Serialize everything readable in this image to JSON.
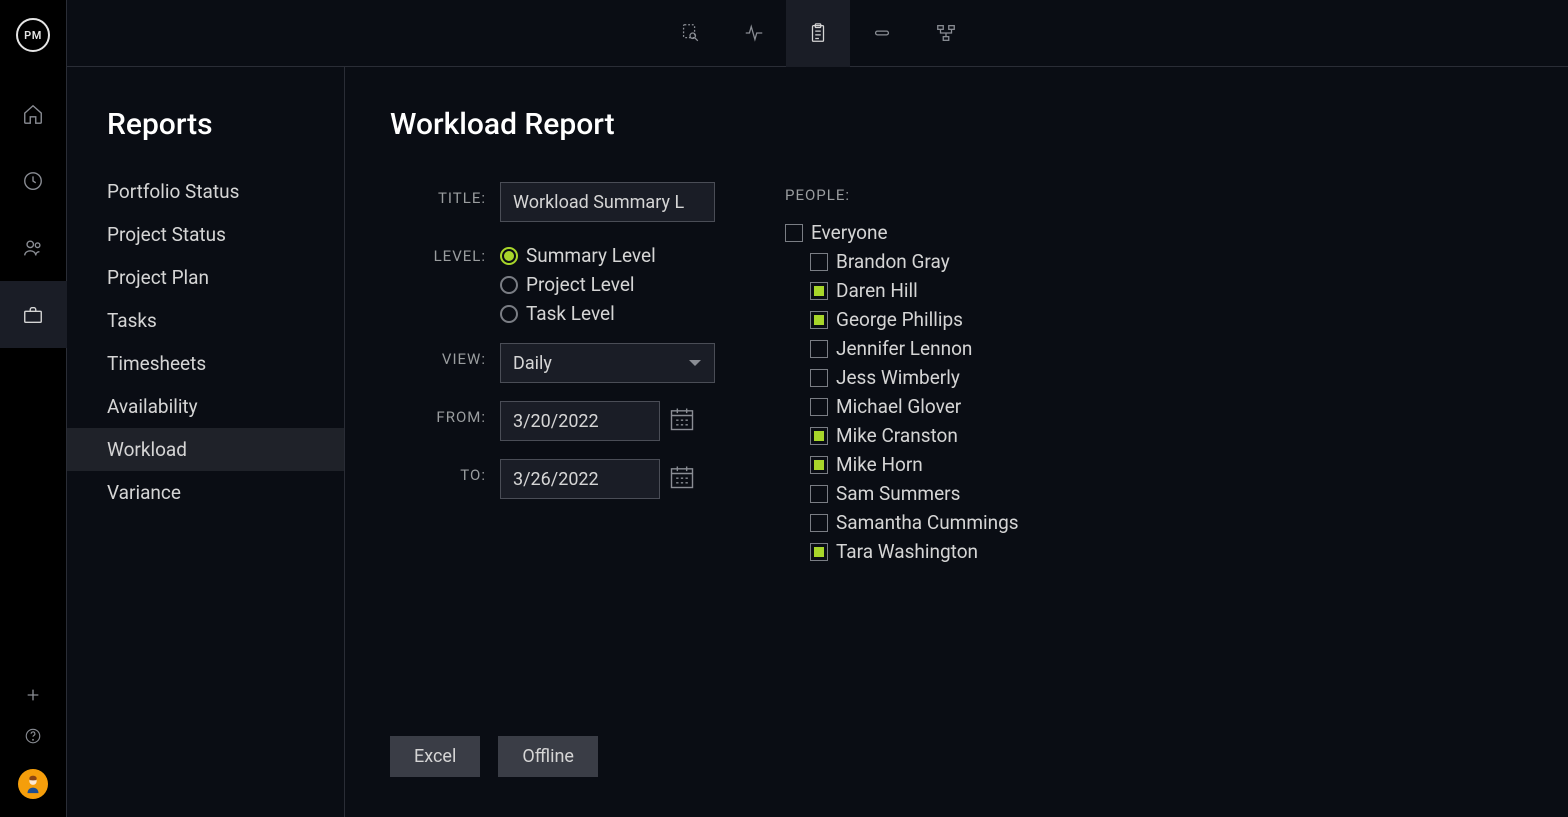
{
  "logo": "PM",
  "rail": {
    "items": [
      "home",
      "time",
      "people",
      "reports"
    ],
    "active": "reports"
  },
  "topbar": {
    "items": [
      "search-doc",
      "activity",
      "clipboard",
      "link",
      "flow"
    ],
    "active": "clipboard"
  },
  "sidebar": {
    "title": "Reports",
    "items": [
      {
        "label": "Portfolio Status"
      },
      {
        "label": "Project Status"
      },
      {
        "label": "Project Plan"
      },
      {
        "label": "Tasks"
      },
      {
        "label": "Timesheets"
      },
      {
        "label": "Availability"
      },
      {
        "label": "Workload",
        "active": true
      },
      {
        "label": "Variance"
      }
    ]
  },
  "panel": {
    "title": "Workload Report",
    "labels": {
      "title": "TITLE:",
      "level": "LEVEL:",
      "view": "VIEW:",
      "from": "FROM:",
      "to": "TO:",
      "people": "PEOPLE:"
    },
    "title_value": "Workload Summary L",
    "levels": [
      {
        "label": "Summary Level",
        "selected": true
      },
      {
        "label": "Project Level",
        "selected": false
      },
      {
        "label": "Task Level",
        "selected": false
      }
    ],
    "view_value": "Daily",
    "from_value": "3/20/2022",
    "to_value": "3/26/2022",
    "people": {
      "everyone": {
        "label": "Everyone",
        "checked": false
      },
      "list": [
        {
          "label": "Brandon Gray",
          "checked": false
        },
        {
          "label": "Daren Hill",
          "checked": true
        },
        {
          "label": "George Phillips",
          "checked": true
        },
        {
          "label": "Jennifer Lennon",
          "checked": false
        },
        {
          "label": "Jess Wimberly",
          "checked": false
        },
        {
          "label": "Michael Glover",
          "checked": false
        },
        {
          "label": "Mike Cranston",
          "checked": true
        },
        {
          "label": "Mike Horn",
          "checked": true
        },
        {
          "label": "Sam Summers",
          "checked": false
        },
        {
          "label": "Samantha Cummings",
          "checked": false
        },
        {
          "label": "Tara Washington",
          "checked": true
        }
      ]
    },
    "actions": {
      "excel": "Excel",
      "offline": "Offline"
    }
  }
}
